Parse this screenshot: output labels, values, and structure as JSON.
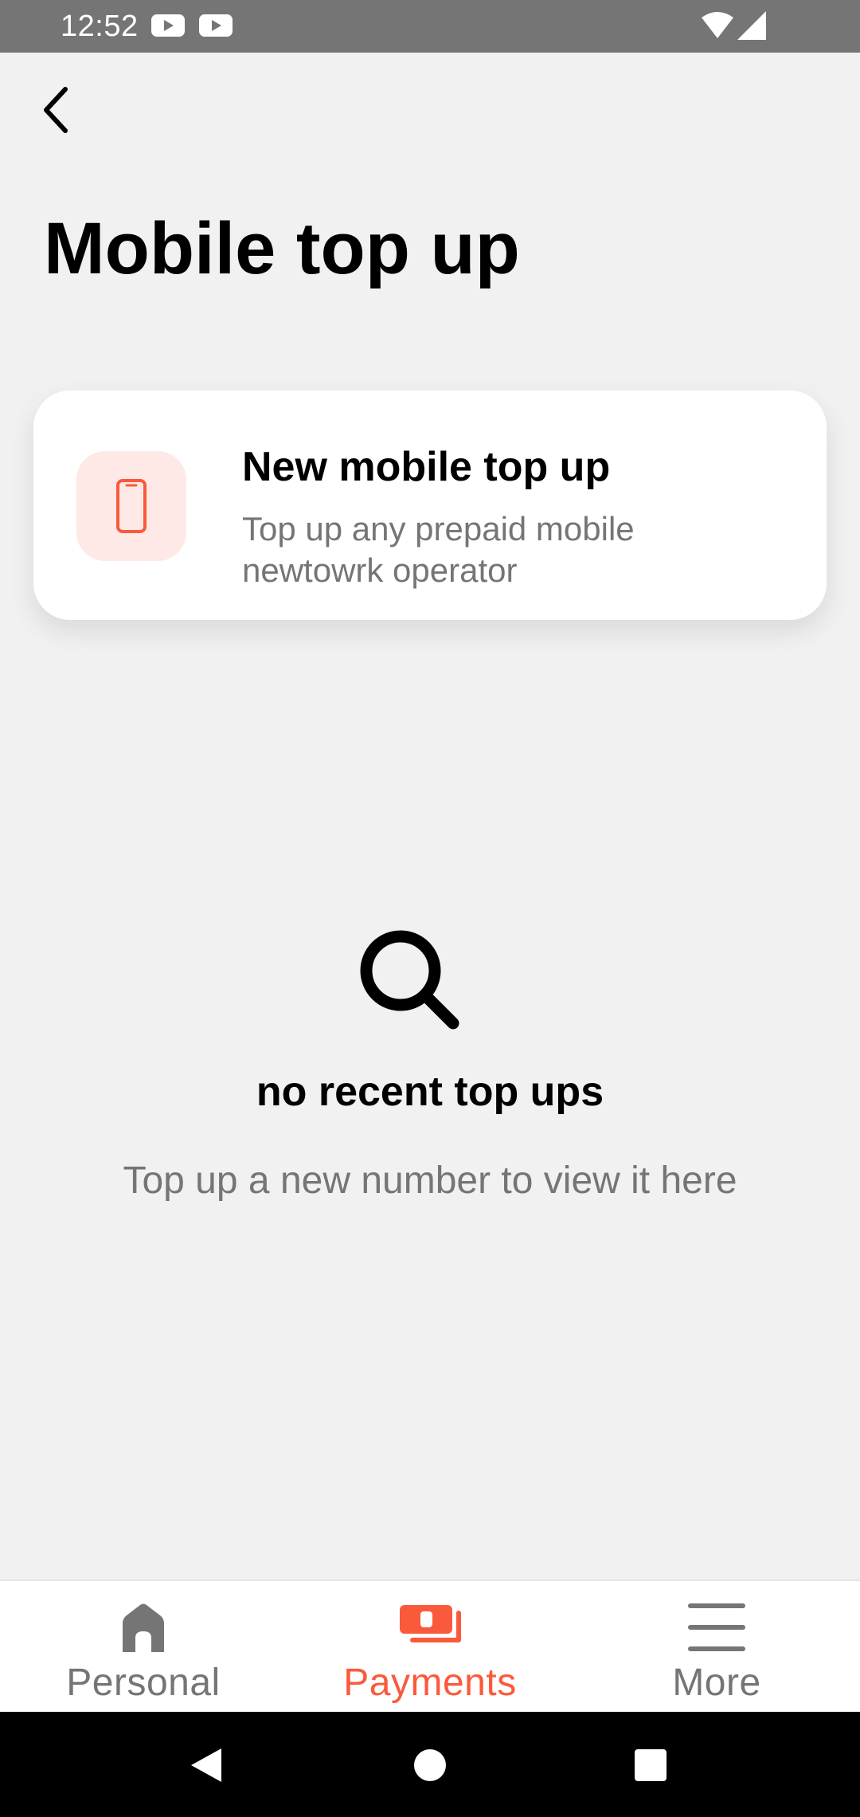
{
  "status_bar": {
    "time": "12:52"
  },
  "header": {
    "title": "Mobile top up"
  },
  "new_topup_card": {
    "title": "New mobile top up",
    "description": "Top up any prepaid mobile newtowrk operator"
  },
  "empty_state": {
    "title": "no recent top ups",
    "subtitle": "Top up a new number to view it here"
  },
  "bottom_nav": {
    "items": [
      {
        "label": "Personal",
        "icon": "home-icon"
      },
      {
        "label": "Payments",
        "icon": "payments-icon",
        "active": true
      },
      {
        "label": "More",
        "icon": "menu-icon"
      }
    ]
  },
  "colors": {
    "accent": "#fa5a3c",
    "icon_bg": "#fee9e6",
    "background": "#f1f1f1",
    "muted_text": "#757575"
  }
}
